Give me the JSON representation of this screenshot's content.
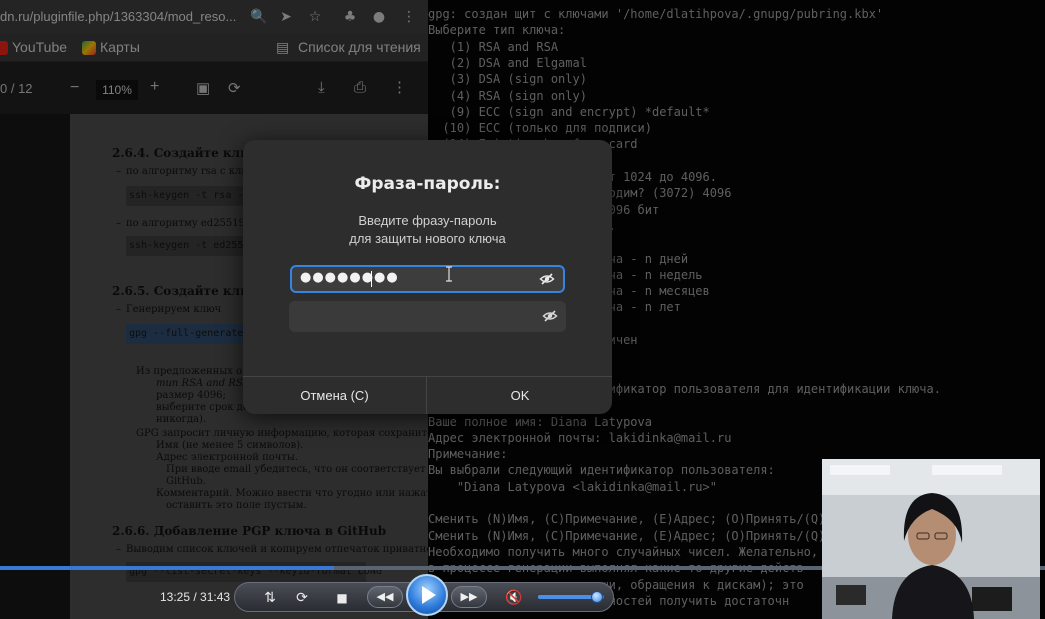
{
  "browser": {
    "url": "dn.ru/pluginfile.php/1363304/mod_reso...",
    "bookmarks": [
      "YouTube",
      "Карты",
      "Список для чтения"
    ],
    "pdf": {
      "page_indicator": "0 / 12",
      "zoom": "110%",
      "content": {
        "h1": "2.6.4.   Создайте ключ",
        "l1": "по алгоритму rsa с ключ",
        "c1": "ssh-keygen -t rsa -b",
        "l2": "по алгоритму ed25519:",
        "c2": "ssh-keygen -t ed2551",
        "h2": "2.6.5.   Создайте ключ",
        "l3": "Генерируем ключ",
        "c3": "gpg --full-generate-",
        "l4": "Из предложенных о",
        "l5": "тип RSA and RSA;",
        "l6": "размер 4096;",
        "l7": "выберите срок дей",
        "l8": "никогда).",
        "l9": "GPG запросит личную информацию, которая сохранитс",
        "l10": "Имя (не менее 5 символов).",
        "l11": "Адрес электронной почты.",
        "l12": "При вводе email убедитесь, что он соответствует ад",
        "l13": "GitHub.",
        "l14": "Комментарий. Можно ввести что угодно или нажат",
        "l15": "оставить это поле пустым.",
        "h3": "2.6.6.   Добавление PGP ключа в GitHub",
        "l16": "Выводим список ключей и копируем отпечаток приватного",
        "c4": "gpg --list-secret-keys --keyid-format LONG"
      }
    }
  },
  "terminal": {
    "lines": [
      "gpg: создан щит с ключами '/home/dlatihpova/.gnupg/pubring.kbx'",
      "Выберите тип ключа:",
      "   (1) RSA and RSA",
      "   (2) DSA and Elgamal",
      "   (3) DSA (sign only)",
      "   (4) RSA (sign only)",
      "   (9) ECC (sign and encrypt) *default*",
      "  (10) ECC (только для подписи)",
      "  (14) Existing key from card",
      "",
      "                      ь от 1024 до 4096.",
      "                      обходим? (3072) 4096",
      "                      - 4096 бит",
      "                      юча.",
      "",
      "                      ключа - n дней",
      "                      ключа - n недель",
      "                      ключа - n месяцев",
      "                      ключа - n лет",
      "",
      "                      раничен",
      "",
      "",
      "                      ентификатор пользователя для идентификации ключа.",
      "",
      "Ваше полное имя: Diana Latypova",
      "Адрес электронной почты: lakidinka@mail.ru",
      "Примечание:",
      "Вы выбрали следующий идентификатор пользователя:",
      "    \"Diana Latypova <lakidinka@mail.ru>\"",
      "",
      "Сменить (N)Имя, (C)Примечание, (E)Адрес; (O)Принять/(Q)",
      "Сменить (N)Имя, (C)Примечание, (E)Адрес; (O)Принять/(Q)",
      "Необходимо получить много случайных чисел. Желательно,",
      "в процессе генерации выполнял какие-то другие действ",
      "(клавиатура, движения мыши, обращения к дискам); это",
      "                      можностей получить достаточн"
    ]
  },
  "dialog": {
    "title": "Фраза-пароль:",
    "message_line1": "Введите фразу-пароль",
    "message_line2": "для защиты нового ключа",
    "passphrase_masked": "●●●●●●●●",
    "confirm_value": "",
    "cancel_label": "Отмена (С)",
    "ok_label": "OK",
    "accent": "#3584e4"
  },
  "player": {
    "time": "13:25 / 31:43",
    "progress": 0.32,
    "volume": 0.9,
    "accent": "#3a78d8"
  }
}
